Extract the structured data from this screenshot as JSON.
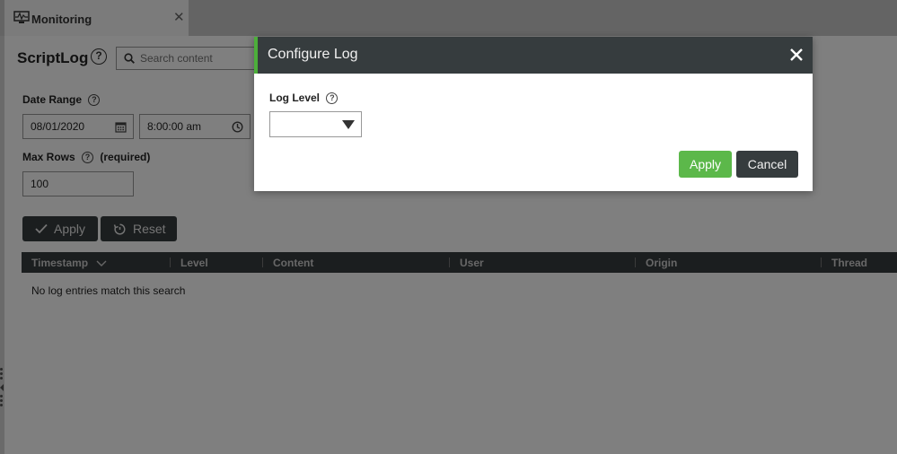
{
  "tab": {
    "title": "Monitoring",
    "close": "✕"
  },
  "page": {
    "title": "ScriptLog",
    "help": "?"
  },
  "search": {
    "placeholder": "Search content"
  },
  "date_range": {
    "label": "Date Range",
    "date": "08/01/2020",
    "time": "8:00:00 am"
  },
  "max_rows": {
    "label": "Max Rows",
    "required": "(required)",
    "value": "100"
  },
  "actions": {
    "apply": "Apply",
    "reset": "Reset"
  },
  "table": {
    "columns": [
      "Timestamp",
      "Level",
      "Content",
      "User",
      "Origin",
      "Thread"
    ],
    "empty_message": "No log entries match this search"
  },
  "modal": {
    "title": "Configure Log",
    "log_level_label": "Log Level",
    "log_level_value": "",
    "apply": "Apply",
    "cancel": "Cancel"
  },
  "colors": {
    "accent": "#5cb84a",
    "dark": "#363c3e"
  }
}
